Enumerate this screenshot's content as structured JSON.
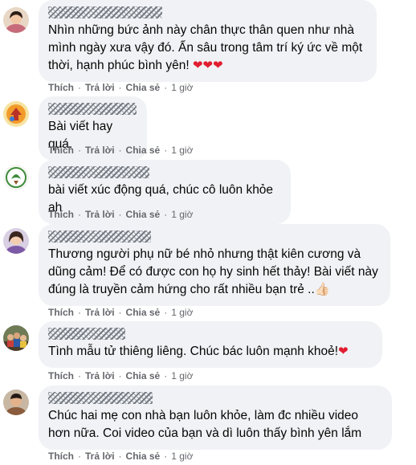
{
  "actions": {
    "like": "Thích",
    "reply": "Trả lời",
    "share": "Chia sẻ",
    "dot": "·"
  },
  "comments": [
    {
      "avatar_icon": "avatar-woman-portrait",
      "text": "Nhìn những bức ảnh này chân thực thân quen như nhà mình ngày xưa vậy đó. Ẩn sâu trong tâm trí ký ức về một thời, hạnh phúc bình yên! ❤❤❤",
      "time": "1 giờ"
    },
    {
      "avatar_icon": "avatar-orange-logo",
      "text": "Bài viết hay quá.",
      "time": "1 giờ"
    },
    {
      "avatar_icon": "avatar-green-emblem",
      "text": "bài viết xúc động quá, chúc cô luôn khỏe ah",
      "time": "1 giờ"
    },
    {
      "avatar_icon": "avatar-woman-portrait",
      "text": "Thương người phụ nữ bé nhỏ nhưng thật kiên cương và dũng cảm! Để có được con họ hy sinh hết thảy! Bài viết này đúng là truyền cảm hứng cho rất nhiều bạn trẻ ..👍🏻",
      "time": "1 giờ"
    },
    {
      "avatar_icon": "avatar-group-photo",
      "text": "Tình mẫu tử thiêng liêng. Chúc bác luôn mạnh khoẻ!❤",
      "time": "1 giờ"
    },
    {
      "avatar_icon": "avatar-man-portrait",
      "text": "Chúc hai mẹ con nhà bạn luôn khỏe, làm đc nhiều video hơn nữa. Coi video của bạn và dì luôn thấy bình yên lắm",
      "time": "1 giờ"
    }
  ]
}
